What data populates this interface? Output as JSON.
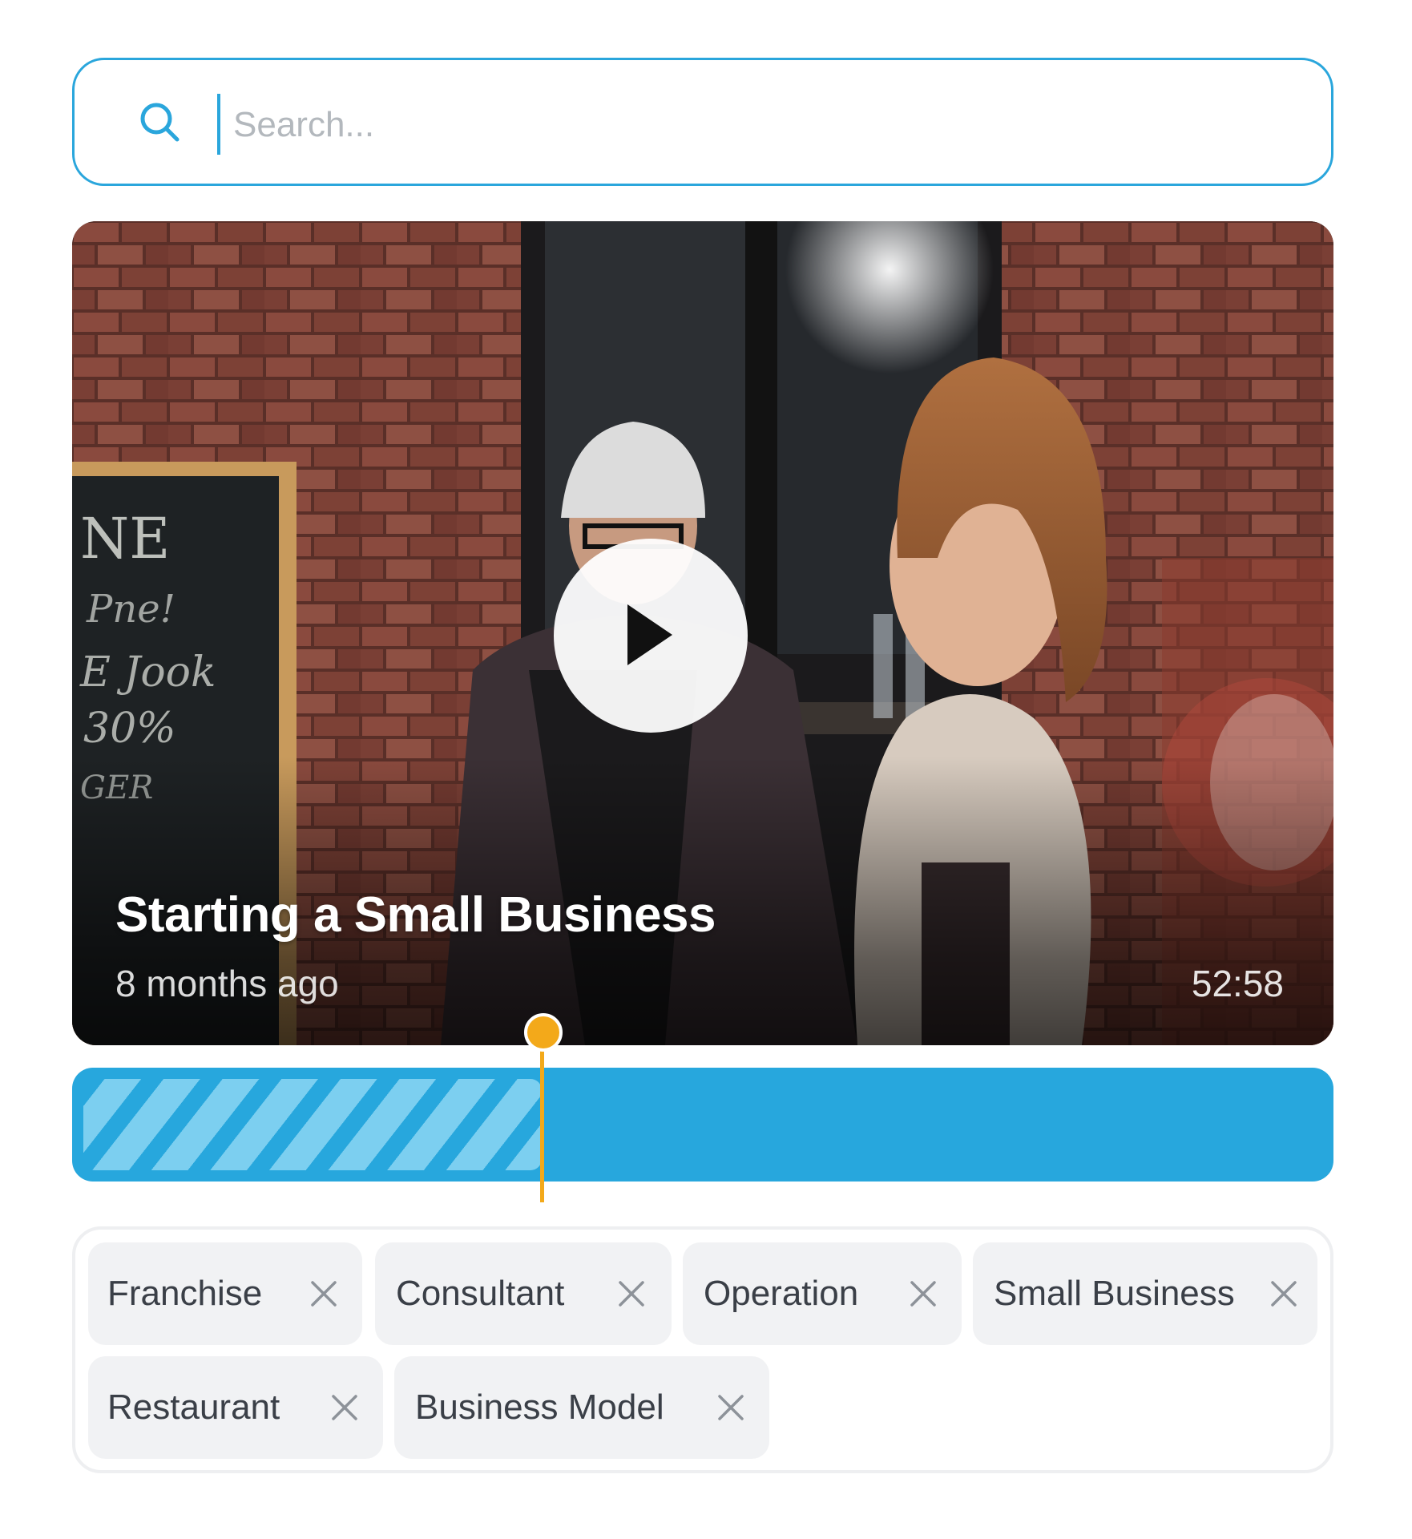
{
  "search": {
    "placeholder": "Search..."
  },
  "video": {
    "title": "Starting a Small Business",
    "posted": "8 months ago",
    "duration": "52:58",
    "progress_fraction": 0.37
  },
  "tags": [
    {
      "label": "Franchise"
    },
    {
      "label": "Consultant"
    },
    {
      "label": "Operation"
    },
    {
      "label": "Small Business"
    },
    {
      "label": "Restaurant"
    },
    {
      "label": "Business Model"
    }
  ],
  "colors": {
    "accent": "#2aa6dc",
    "timeline": "#27a7dd",
    "timeline_played": "#7ccff0",
    "playhead": "#f3a91a",
    "tag_bg": "#f1f2f4",
    "tag_text": "#3a3f47"
  },
  "icons": {
    "search": "search-icon",
    "play": "play-icon",
    "remove": "close-icon"
  }
}
